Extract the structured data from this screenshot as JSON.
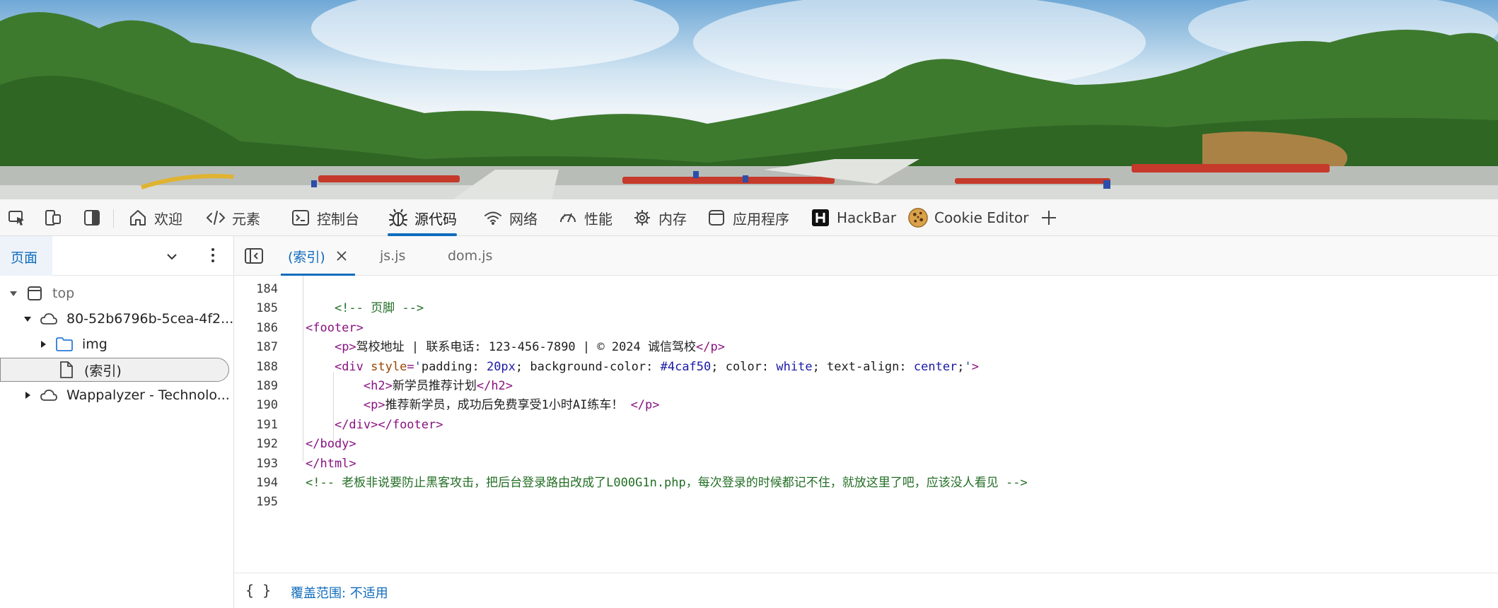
{
  "toolbar": {
    "tabs": [
      {
        "label": "欢迎",
        "icon": "home-icon"
      },
      {
        "label": "元素",
        "icon": "code-icon"
      },
      {
        "label": "控制台",
        "icon": "console-icon"
      },
      {
        "label": "源代码",
        "icon": "bug-icon",
        "active": true
      },
      {
        "label": "网络",
        "icon": "wifi-icon"
      },
      {
        "label": "性能",
        "icon": "gauge-icon"
      },
      {
        "label": "内存",
        "icon": "chip-icon"
      },
      {
        "label": "应用程序",
        "icon": "app-window-icon"
      },
      {
        "label": "HackBar",
        "icon": "hackbar-logo-icon"
      },
      {
        "label": "Cookie Editor",
        "icon": "cookie-icon"
      }
    ],
    "left_icons": [
      "inspect-icon",
      "device-toggle-icon",
      "dock-panel-icon"
    ],
    "add_icon": "plus-icon"
  },
  "navigator": {
    "header_label": "页面",
    "tree": [
      {
        "label": "top",
        "depth": 0,
        "expanded": true,
        "icon": "frame-icon",
        "muted": true
      },
      {
        "label": "80-52b6796b-5cea-4f2...",
        "depth": 1,
        "expanded": true,
        "icon": "cloud-icon"
      },
      {
        "label": "img",
        "depth": 2,
        "expanded": false,
        "icon": "folder-icon"
      },
      {
        "label": "(索引)",
        "depth": 3,
        "icon": "file-icon",
        "selected": true
      },
      {
        "label": "Wappalyzer - Technolo...",
        "depth": 0,
        "expanded": false,
        "icon": "cloud-icon"
      }
    ]
  },
  "editor": {
    "tabs": [
      {
        "label": "(索引)",
        "active": true,
        "closable": true
      },
      {
        "label": "js.js"
      },
      {
        "label": "dom.js"
      }
    ],
    "lines": [
      {
        "n": "184",
        "tokens": []
      },
      {
        "n": "185",
        "tokens": [
          [
            "com",
            "    <!-- 页脚 -->"
          ]
        ]
      },
      {
        "n": "186",
        "tokens": [
          [
            "tag",
            "<footer>"
          ]
        ]
      },
      {
        "n": "187",
        "tokens": [
          [
            "txt",
            "    "
          ],
          [
            "tag",
            "<p>"
          ],
          [
            "txt",
            "驾校地址 | 联系电话: 123-456-7890 | © 2024 诚信驾校"
          ],
          [
            "tag",
            "</p>"
          ]
        ]
      },
      {
        "n": "188",
        "tokens": [
          [
            "txt",
            "    "
          ],
          [
            "tag",
            "<div "
          ],
          [
            "attr",
            "style"
          ],
          [
            "tag",
            "="
          ],
          [
            "str",
            "'"
          ],
          [
            "txt",
            "padding: "
          ],
          [
            "val",
            "20px"
          ],
          [
            "txt",
            "; background-color: "
          ],
          [
            "val",
            "#4caf50"
          ],
          [
            "txt",
            "; color: "
          ],
          [
            "val",
            "white"
          ],
          [
            "txt",
            "; text-align: "
          ],
          [
            "val",
            "center"
          ],
          [
            "txt",
            ";"
          ],
          [
            "str",
            "'"
          ],
          [
            "tag",
            ">"
          ]
        ]
      },
      {
        "n": "189",
        "tokens": [
          [
            "txt",
            "        "
          ],
          [
            "tag",
            "<h2>"
          ],
          [
            "txt",
            "新学员推荐计划"
          ],
          [
            "tag",
            "</h2>"
          ]
        ]
      },
      {
        "n": "190",
        "tokens": [
          [
            "txt",
            "        "
          ],
          [
            "tag",
            "<p>"
          ],
          [
            "txt",
            "推荐新学员，成功后免费享受1小时AI练车！ "
          ],
          [
            "tag",
            "</p>"
          ]
        ]
      },
      {
        "n": "191",
        "tokens": [
          [
            "txt",
            "    "
          ],
          [
            "tag",
            "</div></footer>"
          ]
        ]
      },
      {
        "n": "192",
        "tokens": [
          [
            "tag",
            "</body>"
          ]
        ]
      },
      {
        "n": "193",
        "tokens": [
          [
            "tag",
            "</html>"
          ]
        ]
      },
      {
        "n": "194",
        "tokens": [
          [
            "com",
            "<!-- 老板非说要防止黑客攻击，把后台登录路由改成了L000G1n.php，每次登录的时候都记不住，就放这里了吧，应该没人看见 -->"
          ]
        ]
      },
      {
        "n": "195",
        "tokens": []
      }
    ],
    "status_braces": "{ }",
    "coverage_label": "覆盖范围: 不适用"
  },
  "colors": {
    "accent": "#0f6cbd",
    "tag": "#881280",
    "attr": "#994500",
    "value": "#1a1aa6",
    "comment": "#236e25"
  }
}
